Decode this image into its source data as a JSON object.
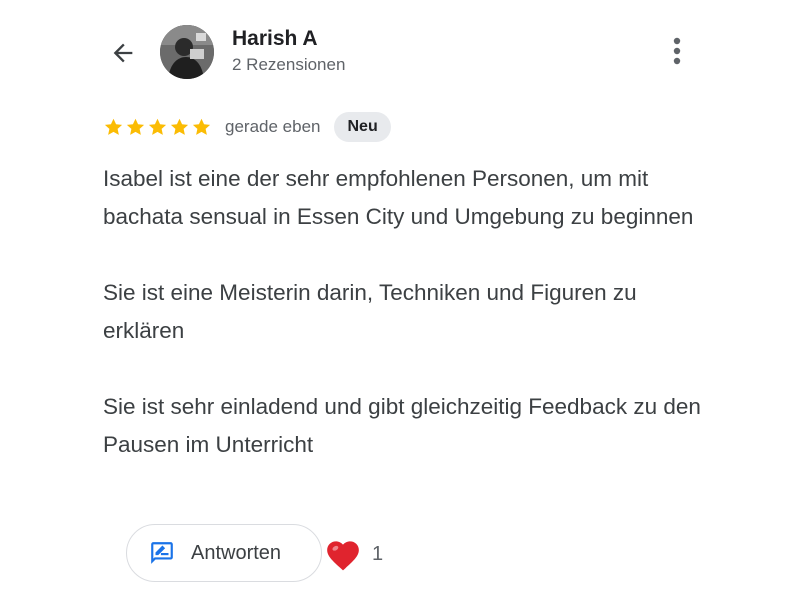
{
  "header": {
    "reviewer_name": "Harish A",
    "reviewer_meta": "2 Rezensionen",
    "icons": {
      "back": "arrow-back-icon",
      "more": "more-vert-icon"
    }
  },
  "review": {
    "rating": 5,
    "max_rating": 5,
    "time": "gerade eben",
    "badge": "Neu",
    "paragraphs": [
      "Isabel ist eine der sehr empfohlenen Personen, um mit bachata sensual in Essen City und Umgebung zu beginnen",
      "Sie ist eine Meisterin darin, Techniken und Figuren zu erklären",
      "Sie ist sehr einladend und gibt gleichzeitig Feedback zu den Pausen im Unterricht"
    ]
  },
  "actions": {
    "reply_label": "Antworten",
    "reply_icon": "rate-review-icon",
    "reaction_icon": "heart-icon",
    "reaction_count": "1"
  },
  "colors": {
    "star": "#fbbc04",
    "reply_icon": "#1a73e8",
    "heart": "#e0242e",
    "badge_bg": "#e8eaed"
  }
}
